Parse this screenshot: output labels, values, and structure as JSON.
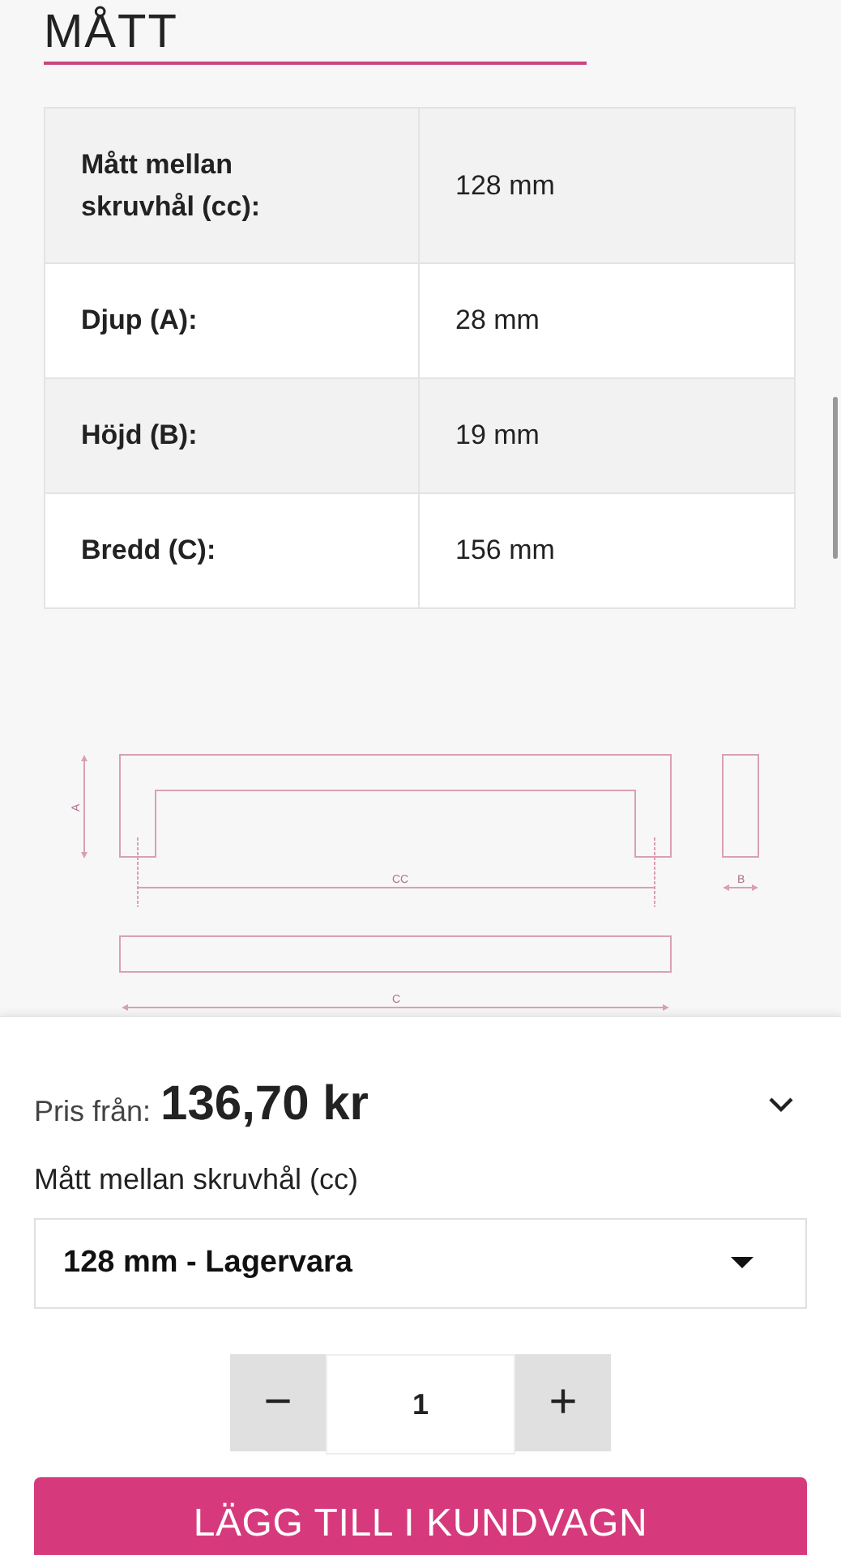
{
  "section_title": "MÅTT",
  "specs": [
    {
      "label": "Mått mellan skruvhål (cc):",
      "value": "128 mm"
    },
    {
      "label": "Djup (A):",
      "value": "28 mm"
    },
    {
      "label": "Höjd (B):",
      "value": "19 mm"
    },
    {
      "label": "Bredd (C):",
      "value": "156 mm"
    }
  ],
  "diagram": {
    "labels": [
      "A",
      "CC",
      "B",
      "C"
    ]
  },
  "purchase": {
    "price_label": "Pris från:",
    "price": "136,70 kr",
    "option_label": "Mått mellan skruvhål (cc)",
    "option_value": "128 mm - Lagervara",
    "quantity": "1",
    "minus": "−",
    "plus": "+",
    "add_button": "LÄGG TILL I KUNDVAGN"
  }
}
